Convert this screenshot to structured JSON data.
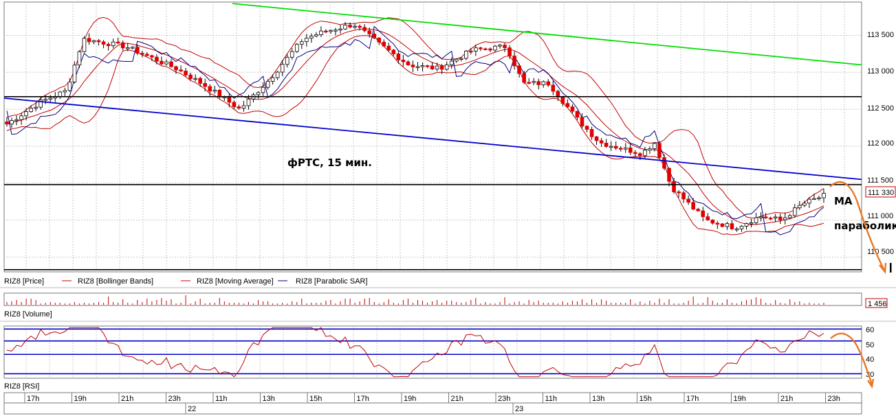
{
  "chart_data": [
    {
      "type": "candlestick",
      "title": "фРТС, 15 мин.",
      "instrument": "RIZ8",
      "y_ticks": [
        "113 500",
        "113 000",
        "112 500",
        "112 000",
        "111 500",
        "111 000",
        "110 500"
      ],
      "ylim": [
        110300,
        113950
      ],
      "last_price_label": "111 330",
      "last_price": 111330,
      "grid": true,
      "legend": [
        "RIZ8 [Price]",
        "RIZ8 [Bollinger Bands]",
        "RIZ8 [Moving Average]",
        "RIZ8 [Parabolic SAR]"
      ],
      "annotations": [
        "MA",
        "параболик"
      ],
      "trend_lines": [
        {
          "color": "#00dd00",
          "from_price": 113930,
          "to_price": 113100
        },
        {
          "color": "#0000cc",
          "from_price": 112650,
          "to_price": 111550
        }
      ],
      "horizontal_levels": [
        112670,
        111480,
        110330
      ],
      "bar_count": 170
    },
    {
      "type": "bar",
      "title": "RIZ8 [Volume]",
      "last_value_label": "1 456"
    },
    {
      "type": "line",
      "title": "RIZ8 [RSI]",
      "y_ticks": [
        "60",
        "50",
        "40",
        "30"
      ],
      "ylim": [
        27,
        62
      ],
      "levels": [
        60,
        52,
        43,
        30
      ]
    }
  ],
  "time_axis": {
    "hours": [
      "17h",
      "19h",
      "21h",
      "23h",
      "11h",
      "13h",
      "15h",
      "17h",
      "19h",
      "21h",
      "23h",
      "11h",
      "13h",
      "15h",
      "17h",
      "19h",
      "21h",
      "23h"
    ],
    "days": [
      "22",
      "23"
    ]
  },
  "colors": {
    "bull_candle": "#ffffff",
    "bear_candle": "#e00000",
    "bollinger": "#c00000",
    "moving_average": "#c00000",
    "parabolic_sar": "#000080",
    "forecast_arrow": "#e87722",
    "grid": "#c8c8c8"
  }
}
